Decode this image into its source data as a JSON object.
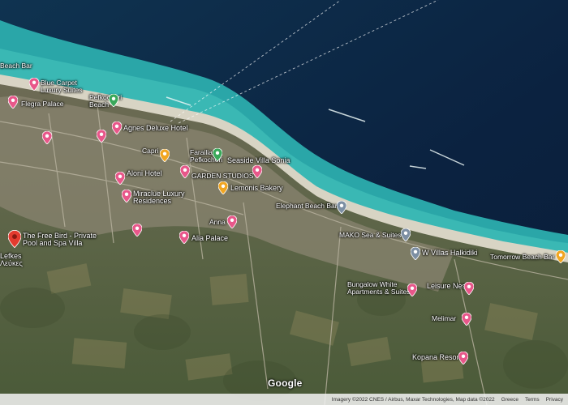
{
  "map": {
    "brand": "Google",
    "footer": {
      "imagery": "Imagery ©2022 CNES / Airbus, Maxar Technologies, Map data ©2022",
      "country": "Greece",
      "terms": "Terms",
      "privacy": "Privacy"
    },
    "colors": {
      "deep_sea": "#0d2746",
      "shallow_sea": "#2aa6a8",
      "beach": "#d8d4c4",
      "land": "#5b6446",
      "pin_hotel": "#e8578a",
      "pin_food": "#f1a622",
      "pin_park": "#3aa85a",
      "pin_selected": "#e33b2f",
      "pin_info": "#7d8fa3"
    },
    "labels": {
      "beach_bar": "Beach Bar",
      "blue_carpet": "Blue Carpet\nLuxury Suites",
      "flegra": "Flegra Palace",
      "pefkochori_beach": "Pefkochori\nBeach",
      "agnes": "Agnes Deluxe Hotel",
      "capri": "Capri",
      "farailia": "Farailia\nPefkochori",
      "seaside": "Seaside Villa Sonia",
      "garden": "GARDEN STUDIOS",
      "aloni": "Aloni Hotel",
      "lemonis": "Lemonis Bakery",
      "miraclue": "Miraclue Luxury\nResidences",
      "elephant": "Elephant Beach Bar",
      "anna": "Anna",
      "free_bird": "The Free Bird - Private\nPool and Spa Villa",
      "lefkes": "Lefkes\nΛεύκες",
      "alia": "Alia Palace",
      "mako": "MAKO Sea & Suites",
      "villas": "W Villas Halkidiki",
      "tomorrow": "Tomorrow Beach Bar",
      "bungalow": "Bungalow White\nApartments & Suites",
      "leisure": "Leisure Nest",
      "melimar": "Melimar",
      "kopana": "Kopana Resort"
    }
  }
}
